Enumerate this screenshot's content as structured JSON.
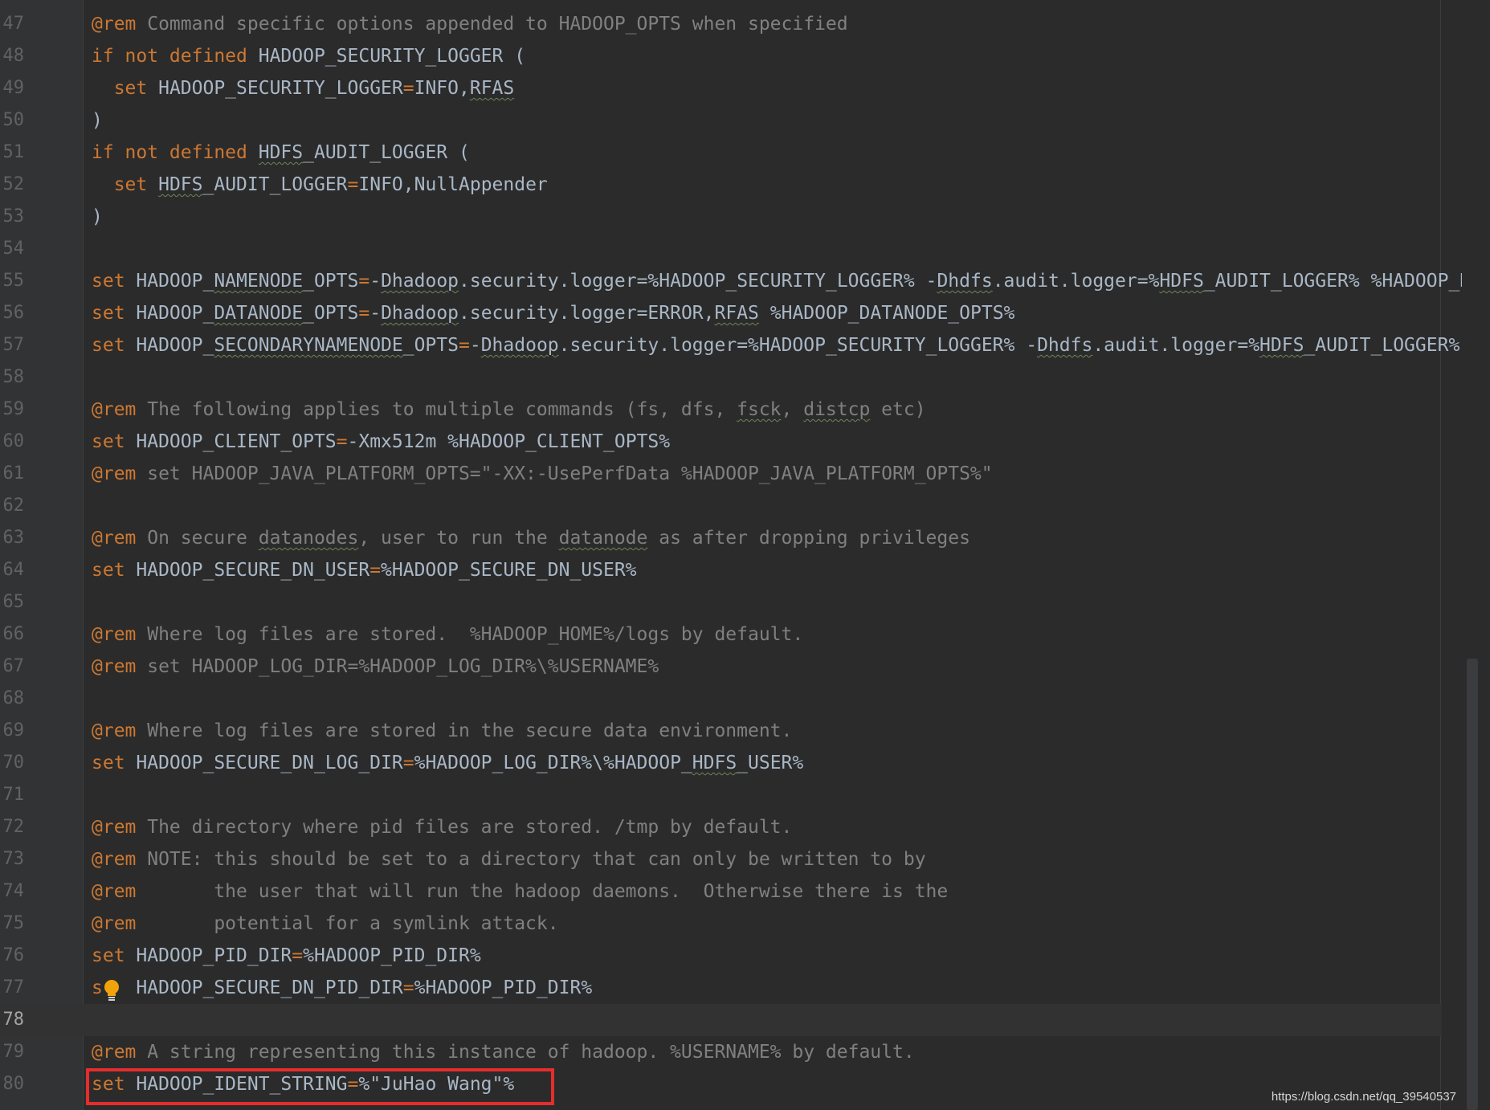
{
  "watermark": "https://blog.csdn.net/qq_39540537",
  "current_line": 78,
  "lines": [
    {
      "n": "47",
      "tokens": [
        {
          "t": "@rem",
          "c": "kw"
        },
        {
          "t": " Command specific options appended to HADOOP_OPTS when specified",
          "c": "cmt"
        }
      ]
    },
    {
      "n": "48",
      "tokens": [
        {
          "t": "if not defined",
          "c": "kw"
        },
        {
          "t": " HADOOP_SECURITY_LOGGER (",
          "c": "var"
        }
      ]
    },
    {
      "n": "49",
      "tokens": [
        {
          "t": "  set",
          "c": "kw"
        },
        {
          "t": " HADOOP_SECURITY_LOGGER",
          "c": "var"
        },
        {
          "t": "=",
          "c": "op"
        },
        {
          "t": "INFO,",
          "c": "var"
        },
        {
          "t": "RFAS",
          "c": "var typo"
        }
      ]
    },
    {
      "n": "50",
      "tokens": [
        {
          "t": ")",
          "c": "var"
        }
      ]
    },
    {
      "n": "51",
      "tokens": [
        {
          "t": "if not defined",
          "c": "kw"
        },
        {
          "t": " ",
          "c": "var"
        },
        {
          "t": "HDFS",
          "c": "var typo"
        },
        {
          "t": "_AUDIT_LOGGER (",
          "c": "var"
        }
      ]
    },
    {
      "n": "52",
      "tokens": [
        {
          "t": "  set",
          "c": "kw"
        },
        {
          "t": " ",
          "c": "var"
        },
        {
          "t": "HDFS",
          "c": "var typo"
        },
        {
          "t": "_AUDIT_LOGGER",
          "c": "var"
        },
        {
          "t": "=",
          "c": "op"
        },
        {
          "t": "INFO,NullAppender",
          "c": "var"
        }
      ]
    },
    {
      "n": "53",
      "tokens": [
        {
          "t": ")",
          "c": "var"
        }
      ]
    },
    {
      "n": "54",
      "tokens": []
    },
    {
      "n": "55",
      "tokens": [
        {
          "t": "set",
          "c": "kw"
        },
        {
          "t": " HADOOP_",
          "c": "var"
        },
        {
          "t": "NAMENODE",
          "c": "var typo"
        },
        {
          "t": "_OPTS",
          "c": "var"
        },
        {
          "t": "=",
          "c": "op"
        },
        {
          "t": "-",
          "c": "var"
        },
        {
          "t": "Dhadoop",
          "c": "var typo"
        },
        {
          "t": ".security.logger=%HADOOP_SECURITY_LOGGER% -",
          "c": "var"
        },
        {
          "t": "Dhdfs",
          "c": "var typo"
        },
        {
          "t": ".audit.logger=%",
          "c": "var"
        },
        {
          "t": "HDFS",
          "c": "var typo"
        },
        {
          "t": "_AUDIT_LOGGER% %HADOOP_N",
          "c": "var"
        }
      ]
    },
    {
      "n": "56",
      "tokens": [
        {
          "t": "set",
          "c": "kw"
        },
        {
          "t": " HADOOP_",
          "c": "var"
        },
        {
          "t": "DATANODE",
          "c": "var typo"
        },
        {
          "t": "_OPTS",
          "c": "var"
        },
        {
          "t": "=",
          "c": "op"
        },
        {
          "t": "-",
          "c": "var"
        },
        {
          "t": "Dhadoop",
          "c": "var typo"
        },
        {
          "t": ".security.logger=ERROR,",
          "c": "var"
        },
        {
          "t": "RFAS",
          "c": "var typo"
        },
        {
          "t": " %HADOOP_DATANODE_OPTS%",
          "c": "var"
        }
      ]
    },
    {
      "n": "57",
      "tokens": [
        {
          "t": "set",
          "c": "kw"
        },
        {
          "t": " HADOOP_",
          "c": "var"
        },
        {
          "t": "SECONDARYNAMENODE",
          "c": "var typo"
        },
        {
          "t": "_OPTS",
          "c": "var"
        },
        {
          "t": "=",
          "c": "op"
        },
        {
          "t": "-",
          "c": "var"
        },
        {
          "t": "Dhadoop",
          "c": "var typo"
        },
        {
          "t": ".security.logger=%HADOOP_SECURITY_LOGGER% -",
          "c": "var"
        },
        {
          "t": "Dhdfs",
          "c": "var typo"
        },
        {
          "t": ".audit.logger=%",
          "c": "var"
        },
        {
          "t": "HDFS",
          "c": "var typo"
        },
        {
          "t": "_AUDIT_LOGGER%",
          "c": "var"
        }
      ]
    },
    {
      "n": "58",
      "tokens": []
    },
    {
      "n": "59",
      "tokens": [
        {
          "t": "@rem",
          "c": "kw"
        },
        {
          "t": " The following applies to multiple commands (fs, dfs, ",
          "c": "cmt"
        },
        {
          "t": "fsck",
          "c": "cmt typo"
        },
        {
          "t": ", ",
          "c": "cmt"
        },
        {
          "t": "distcp",
          "c": "cmt typo"
        },
        {
          "t": " etc)",
          "c": "cmt"
        }
      ]
    },
    {
      "n": "60",
      "tokens": [
        {
          "t": "set",
          "c": "kw"
        },
        {
          "t": " HADOOP_CLIENT_OPTS",
          "c": "var"
        },
        {
          "t": "=",
          "c": "op"
        },
        {
          "t": "-Xmx512m %HADOOP_CLIENT_OPTS%",
          "c": "var"
        }
      ]
    },
    {
      "n": "61",
      "tokens": [
        {
          "t": "@rem",
          "c": "kw"
        },
        {
          "t": " set HADOOP_JAVA_PLATFORM_OPTS=\"-XX:-UsePerfData %HADOOP_JAVA_PLATFORM_OPTS%\"",
          "c": "cmt"
        }
      ]
    },
    {
      "n": "62",
      "tokens": []
    },
    {
      "n": "63",
      "tokens": [
        {
          "t": "@rem",
          "c": "kw"
        },
        {
          "t": " On secure ",
          "c": "cmt"
        },
        {
          "t": "datanodes",
          "c": "cmt typo"
        },
        {
          "t": ", user to run the ",
          "c": "cmt"
        },
        {
          "t": "datanode",
          "c": "cmt typo"
        },
        {
          "t": " as after dropping privileges",
          "c": "cmt"
        }
      ]
    },
    {
      "n": "64",
      "tokens": [
        {
          "t": "set",
          "c": "kw"
        },
        {
          "t": " HADOOP_SECURE_DN_USER",
          "c": "var"
        },
        {
          "t": "=",
          "c": "op"
        },
        {
          "t": "%HADOOP_SECURE_DN_USER%",
          "c": "var"
        }
      ]
    },
    {
      "n": "65",
      "tokens": []
    },
    {
      "n": "66",
      "tokens": [
        {
          "t": "@rem",
          "c": "kw"
        },
        {
          "t": " Where log files are stored.  %HADOOP_HOME%/logs by default.",
          "c": "cmt"
        }
      ]
    },
    {
      "n": "67",
      "tokens": [
        {
          "t": "@rem",
          "c": "kw"
        },
        {
          "t": " set HADOOP_LOG_DIR=%HADOOP_LOG_DIR%\\%USERNAME%",
          "c": "cmt"
        }
      ]
    },
    {
      "n": "68",
      "tokens": []
    },
    {
      "n": "69",
      "tokens": [
        {
          "t": "@rem",
          "c": "kw"
        },
        {
          "t": " Where log files are stored in the secure data environment.",
          "c": "cmt"
        }
      ]
    },
    {
      "n": "70",
      "tokens": [
        {
          "t": "set",
          "c": "kw"
        },
        {
          "t": " HADOOP_SECURE_DN_LOG_DIR",
          "c": "var"
        },
        {
          "t": "=",
          "c": "op"
        },
        {
          "t": "%HADOOP_LOG_DIR%\\%HADOOP_",
          "c": "var"
        },
        {
          "t": "HDFS",
          "c": "var typo"
        },
        {
          "t": "_USER%",
          "c": "var"
        }
      ]
    },
    {
      "n": "71",
      "tokens": []
    },
    {
      "n": "72",
      "tokens": [
        {
          "t": "@rem",
          "c": "kw"
        },
        {
          "t": " The directory where pid files are stored. /tmp by default.",
          "c": "cmt"
        }
      ]
    },
    {
      "n": "73",
      "tokens": [
        {
          "t": "@rem",
          "c": "kw"
        },
        {
          "t": " NOTE: this should be set to a directory that can only be written to by",
          "c": "cmt"
        }
      ]
    },
    {
      "n": "74",
      "tokens": [
        {
          "t": "@rem",
          "c": "kw"
        },
        {
          "t": "       the user that will run the hadoop daemons.  Otherwise there is the",
          "c": "cmt"
        }
      ]
    },
    {
      "n": "75",
      "tokens": [
        {
          "t": "@rem",
          "c": "kw"
        },
        {
          "t": "       potential for a symlink attack.",
          "c": "cmt"
        }
      ]
    },
    {
      "n": "76",
      "tokens": [
        {
          "t": "set",
          "c": "kw"
        },
        {
          "t": " HADOOP_PID_DIR",
          "c": "var"
        },
        {
          "t": "=",
          "c": "op"
        },
        {
          "t": "%HADOOP_PID_DIR%",
          "c": "var"
        }
      ]
    },
    {
      "n": "77",
      "tokens": [
        {
          "t": "s",
          "c": "kw"
        },
        {
          "t": "  ",
          "c": "kw"
        },
        {
          "t": " HADOOP_SECURE_DN_PID_DIR",
          "c": "var"
        },
        {
          "t": "=",
          "c": "op"
        },
        {
          "t": "%HADOOP_PID_DIR%",
          "c": "var"
        }
      ]
    },
    {
      "n": "78",
      "tokens": []
    },
    {
      "n": "79",
      "tokens": [
        {
          "t": "@rem",
          "c": "kw"
        },
        {
          "t": " A string representing this instance of hadoop. %USERNAME% by default.",
          "c": "cmt"
        }
      ]
    },
    {
      "n": "80",
      "tokens": [
        {
          "t": "set",
          "c": "kw"
        },
        {
          "t": " HADOOP_IDENT_STRING",
          "c": "var"
        },
        {
          "t": "=",
          "c": "op"
        },
        {
          "t": "%\"JuHao Wang\"%",
          "c": "var"
        }
      ]
    }
  ]
}
